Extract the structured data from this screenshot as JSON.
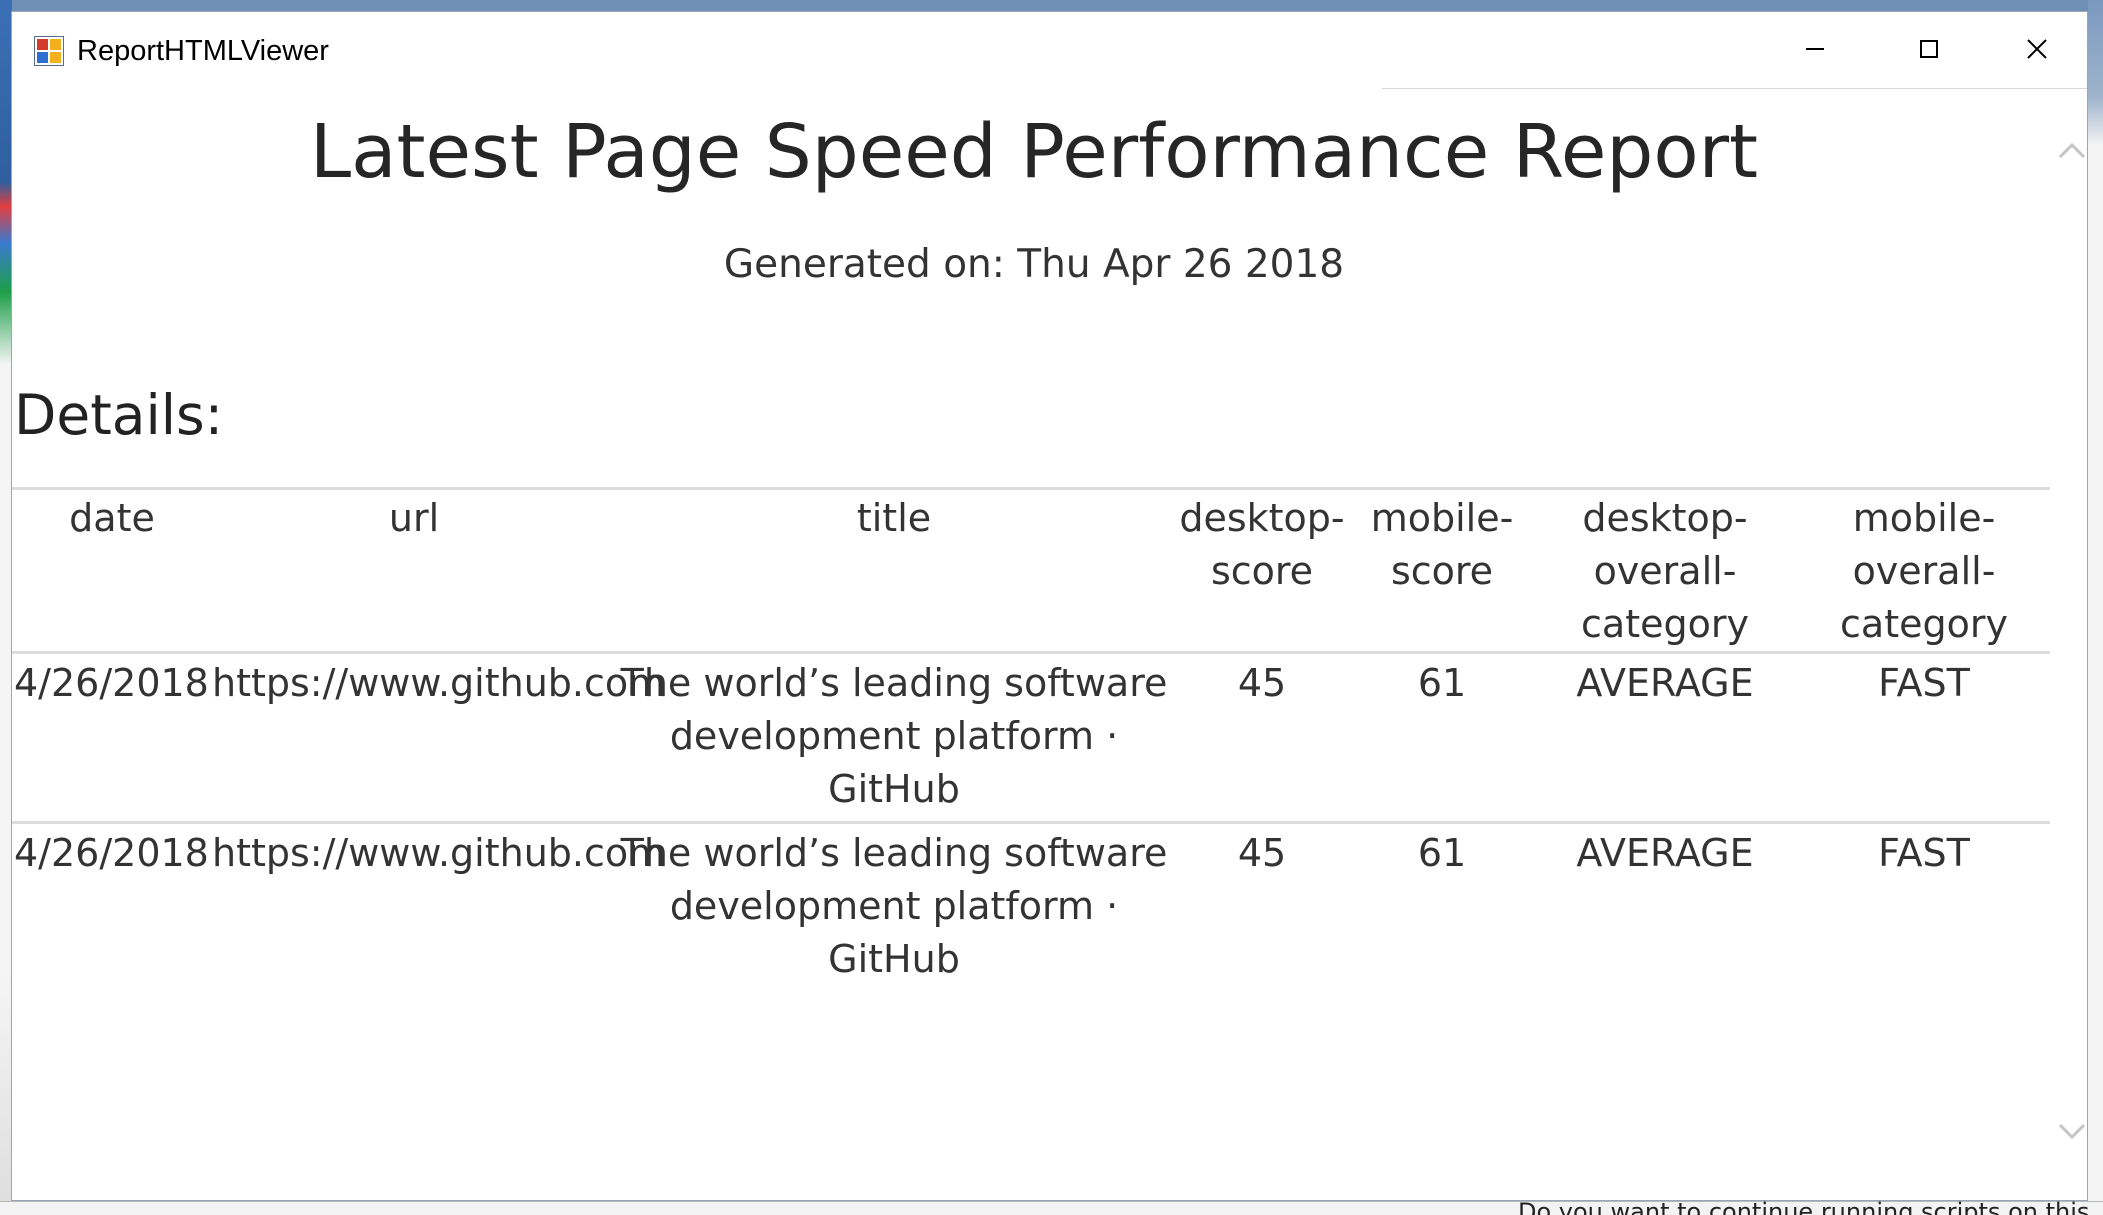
{
  "window": {
    "title": "ReportHTMLViewer"
  },
  "report": {
    "title": "Latest Page Speed Performance Report",
    "generated": "Generated on: Thu Apr 26 2018",
    "section_heading": "Details:"
  },
  "table": {
    "headers": {
      "date": "date",
      "url": "url",
      "title": "title",
      "desktop_score_1": "desktop-",
      "desktop_score_2": "score",
      "mobile_score_1": "mobile-",
      "mobile_score_2": "score",
      "desktop_cat_1": "desktop-",
      "desktop_cat_2": "overall-",
      "desktop_cat_3": "category",
      "mobile_cat_1": "mobile-",
      "mobile_cat_2": "overall-",
      "mobile_cat_3": "category"
    },
    "rows": [
      {
        "date": "4/26/2018",
        "url": "https://www.github.com",
        "title": "The world’s leading software development platform · GitHub",
        "desktop_score": "45",
        "mobile_score": "61",
        "desktop_category": "AVERAGE",
        "mobile_category": "FAST"
      },
      {
        "date": "4/26/2018",
        "url": "https://www.github.com",
        "title": "The world’s leading software development platform · GitHub",
        "desktop_score": "45",
        "mobile_score": "61",
        "desktop_category": "AVERAGE",
        "mobile_category": "FAST"
      }
    ]
  },
  "background": {
    "snippet": "Do you want to continue running scripts on this"
  },
  "icons": {
    "app": "app-window-icon",
    "minimize": "minimize-icon",
    "maximize": "maximize-icon",
    "close": "close-icon",
    "scroll_up": "chevron-up-icon",
    "scroll_down": "chevron-down-icon"
  }
}
